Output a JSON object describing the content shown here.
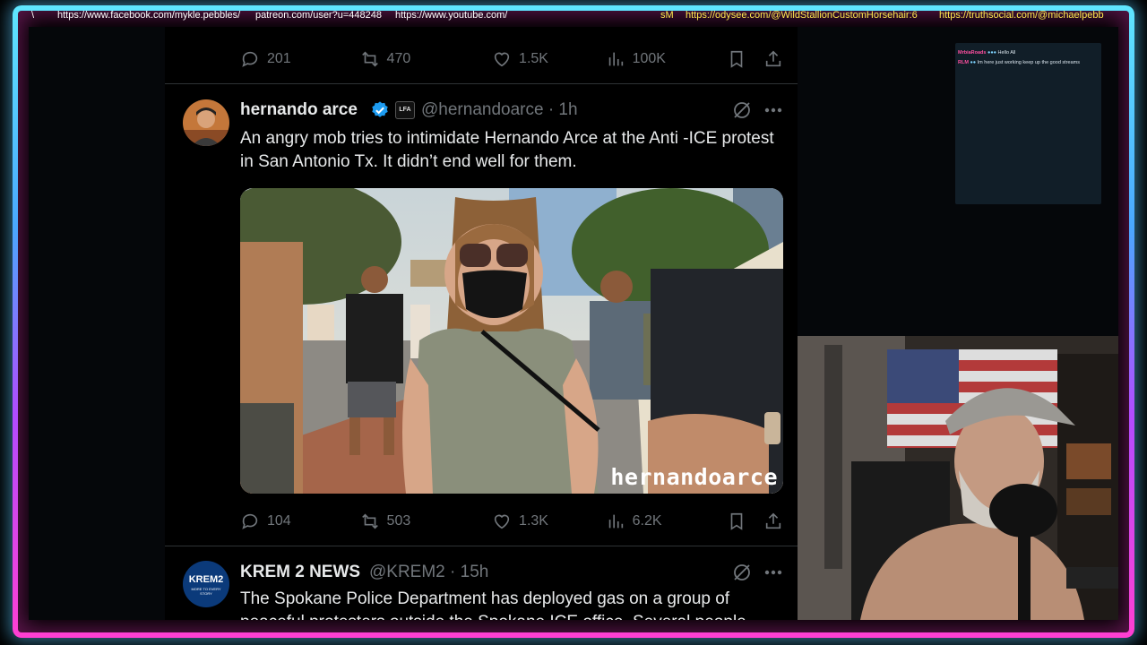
{
  "ticker": {
    "left_mark": "\\",
    "links": [
      "https://www.facebook.com/mykle.pebbles/",
      "patreon.com/user?u=448248",
      "https://www.youtube.com/",
      "sM",
      "https://odysee.com/@WildStallionCustomHorsehair:6",
      "https://truthsocial.com/@michaelpebb"
    ]
  },
  "top_actions": {
    "replies": "201",
    "reposts": "470",
    "likes": "1.5K",
    "views": "100K"
  },
  "tweet1": {
    "name": "hernando arce",
    "handle": "@hernandoarce",
    "time": "· 1h",
    "badge": "LFA",
    "text": "An angry mob tries to intimidate Hernando Arce at the Anti -ICE protest in San Antonio Tx.  It didn’t end well for them.",
    "watermark": "hernandoarce",
    "actions": {
      "replies": "104",
      "reposts": "503",
      "likes": "1.3K",
      "views": "6.2K"
    }
  },
  "tweet2": {
    "name": "KREM 2 NEWS",
    "handle": "@KREM2",
    "time": "· 15h",
    "avatar_text": "KREM2",
    "avatar_sub": "MORE TO EVERY STORY",
    "text": "The Spokane Police Department has deployed gas on a group of peaceful protesters outside the Spokane ICE office. Several people have been arrested."
  },
  "chat": {
    "messages": [
      {
        "user": "MrbiaRoads",
        "msg": "Hello All"
      },
      {
        "user": "RLM",
        "msg": "Im here just working keep up the good streams"
      }
    ]
  },
  "colors": {
    "verified": "#1d9bf0",
    "muted": "#71767b",
    "text": "#e7e9ea",
    "ticker_gold": "#ffe94d"
  }
}
